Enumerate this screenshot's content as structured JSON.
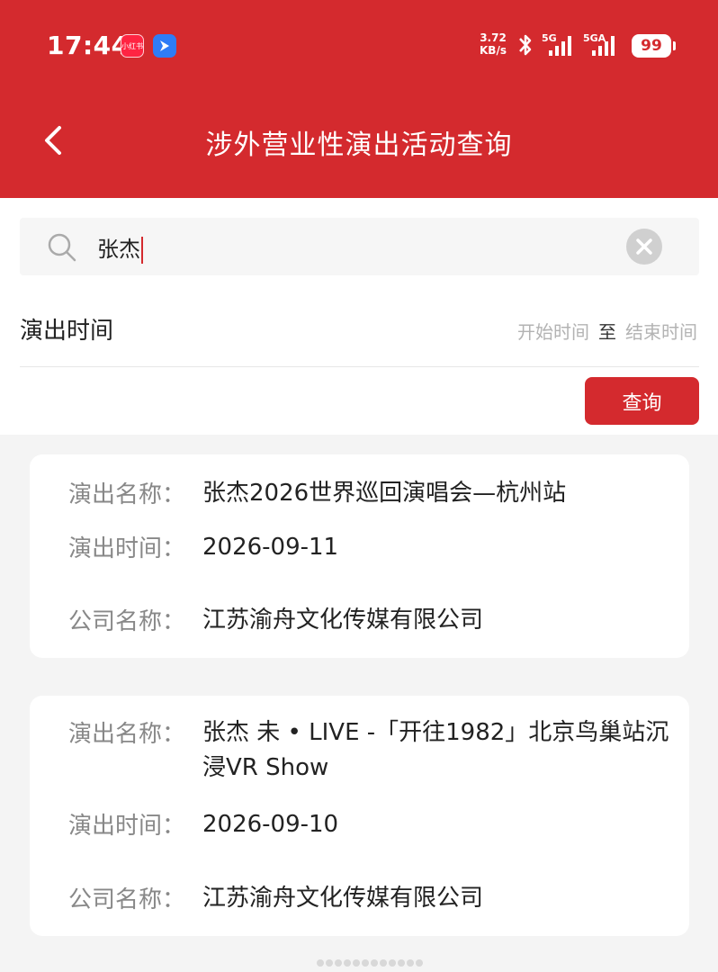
{
  "status_bar": {
    "time": "17:44",
    "app_icon_1_text": "小红书",
    "net_speed_value": "3.72",
    "net_speed_unit": "KB/s",
    "signal_1_label": "5G",
    "signal_2_label": "5GA",
    "battery": "99"
  },
  "header": {
    "title": "涉外营业性演出活动查询"
  },
  "search": {
    "value": "张杰"
  },
  "filter": {
    "time_label": "演出时间",
    "start_placeholder": "开始时间",
    "separator": "至",
    "end_placeholder": "结束时间",
    "query_button": "查询"
  },
  "labels": {
    "name": "演出名称：",
    "time": "演出时间：",
    "company": "公司名称："
  },
  "results": [
    {
      "name": "张杰2026世界巡回演唱会—杭州站",
      "time": "2026-09-11",
      "company": "江苏渝舟文化传媒有限公司"
    },
    {
      "name": "张杰 未 • LIVE -「开往1982」北京鸟巢站沉浸VR Show",
      "time": "2026-09-10",
      "company": "江苏渝舟文化传媒有限公司"
    }
  ],
  "colors": {
    "brand_red": "#d42a2e",
    "label_gray": "#888888",
    "page_bg": "#f4f4f4"
  }
}
